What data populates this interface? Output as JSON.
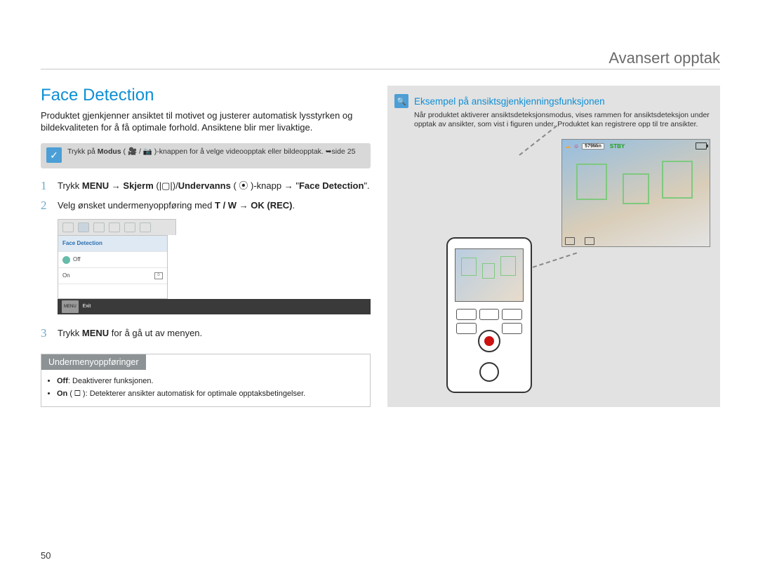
{
  "page_number": "50",
  "header": {
    "title": "Avansert opptak"
  },
  "left": {
    "section_title": "Face Detection",
    "intro": "Produktet gjenkjenner ansiktet til motivet og justerer automatisk lysstyrken og bildekvaliteten for å få optimale forhold. Ansiktene blir mer livaktige.",
    "tip": {
      "icon_name": "check-icon",
      "text_pre": "Trykk på ",
      "text_bold": "Modus",
      "text_post": " ( 🎥 / 📷 )-knappen for å velge videoopptak eller bildeopptak. ➥side 25"
    },
    "steps": [
      {
        "n": "1",
        "pre": "Trykk ",
        "b1": "MENU",
        "mid1": " → ",
        "b2": "Skjerm",
        "mid2": " (|▢|)/",
        "b3": "Undervanns",
        "mid3": " ( ⦿ )-knapp → \"",
        "b4": "Face Detection",
        "post": "\"."
      },
      {
        "n": "2",
        "text_pre": "Velg ønsket undermenyoppføring med ",
        "b1": "T / W",
        "mid": " → ",
        "b2": "OK (REC)",
        "post": "."
      },
      {
        "n": "3",
        "text_pre": "Trykk ",
        "b1": "MENU",
        "post": " for å gå ut av menyen."
      }
    ],
    "menu": {
      "title": "Face Detection",
      "options": [
        "Off",
        "On"
      ],
      "selected_index": 0,
      "exit_btn": "MENU",
      "exit_label": "Exit"
    },
    "submenu_box": {
      "heading": "Undermenyoppføringer",
      "items": [
        {
          "b": "Off",
          "rest": ": Deaktiverer funksjonen."
        },
        {
          "b": "On",
          "rest": " ( 🞏 ): Detekterer ansikter automatisk for optimale opptaksbetingelser."
        }
      ]
    }
  },
  "right": {
    "icon": "magnify-icon",
    "heading": "Eksempel på ansiktsgjenkjenningsfunksjonen",
    "text": "Når produktet aktiverer ansiktsdeteksjonsmodus, vises rammen for ansiktsdeteksjon under opptak av ansikter, som vist i figuren under. Produktet kan registrere opp til tre ansikter.",
    "overlay": {
      "time_remaining": "579Min",
      "status": "STBY"
    }
  }
}
